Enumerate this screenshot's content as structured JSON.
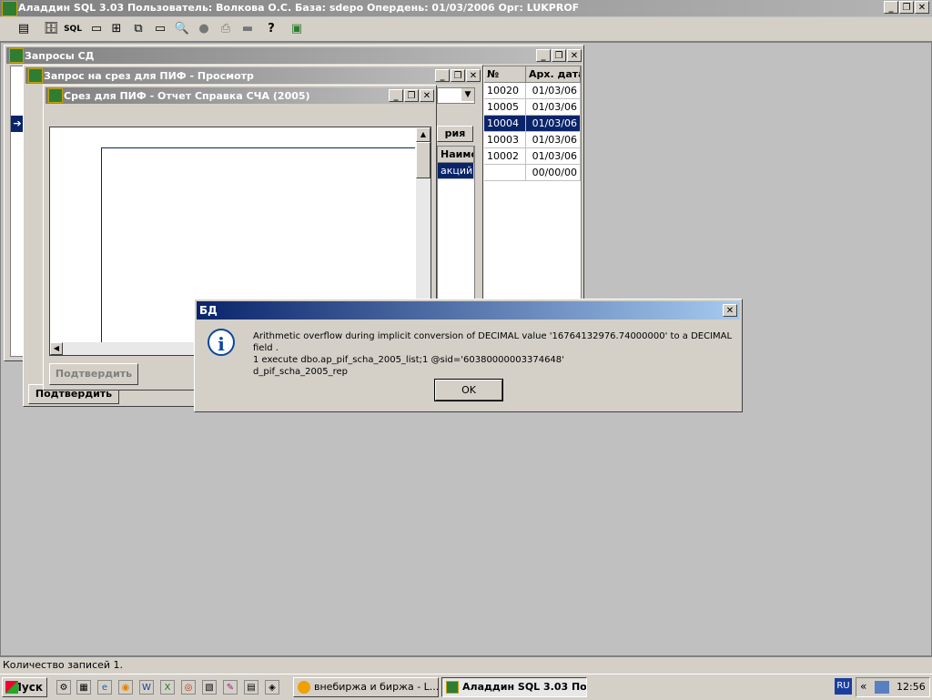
{
  "app": {
    "title": "Аладдин SQL 3.03 Пользователь: Волкова О.С. База: sdepo Опердень: 01/03/2006 Орг: LUKPROF",
    "caption_buttons": [
      "_",
      "❐",
      "✕"
    ]
  },
  "toolbar": {
    "icons": [
      "▤",
      "🗄",
      "SQL",
      "▭",
      "⊞",
      "⧉",
      "▭",
      "🔍",
      "●",
      "⎙",
      "▬",
      "?",
      "▣"
    ]
  },
  "win_queries": {
    "title": "Запросы СД",
    "col_no": "№",
    "col_arch": "Арх. дата",
    "rows": [
      {
        "no": "10020",
        "date": "01/03/06"
      },
      {
        "no": "10005",
        "date": "01/03/06"
      },
      {
        "no": "10004",
        "date": "01/03/06"
      },
      {
        "no": "10003",
        "date": "01/03/06"
      },
      {
        "no": "10002",
        "date": "01/03/06"
      },
      {
        "no": "",
        "date": "00/00/00"
      }
    ],
    "confirm": "Подтвердить"
  },
  "win_request": {
    "title": "Запрос на срез для ПИФ - Просмотр",
    "tab_partial": "рия",
    "col_partial": "Наимено",
    "row_partial": "акций '"
  },
  "win_report": {
    "title": "Срез для ПИФ - Отчет Справка СЧА (2005)",
    "confirm": "Подтвердить"
  },
  "dialog": {
    "title": "БД",
    "line1": "Arithmetic overflow during implicit conversion of DECIMAL value '16764132976.74000000' to a DECIMAL field .",
    "line2": "1 execute dbo.ap_pif_scha_2005_list;1 @sid='60380000003374648'",
    "line3": "d_pif_scha_2005_rep",
    "ok": "OK"
  },
  "status": {
    "text": "Количество записей 1."
  },
  "taskbar": {
    "start": "Пуск",
    "quick": [
      "⚙",
      "▦",
      "e",
      "◉",
      "W",
      "X",
      "◎",
      "▧",
      "✎",
      "▤",
      "◈"
    ],
    "task1": "внебиржа и биржа - L...",
    "task2": "Аладдин SQL 3.03 По...",
    "lang": "RU",
    "clock": "12:56"
  },
  "colors": {
    "selection": "#0a246a",
    "dialog_title_start": "#0a246a",
    "dialog_title_end": "#a6caf0"
  }
}
